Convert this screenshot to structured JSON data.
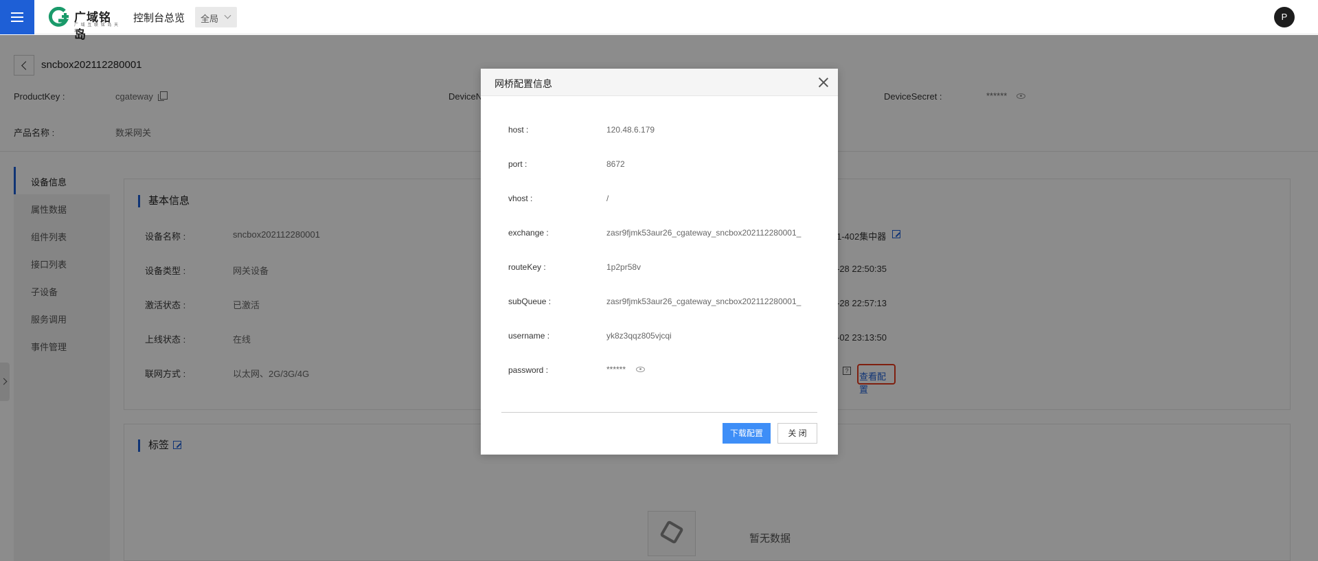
{
  "header": {
    "brand": "广域铭岛",
    "brand_sub": "广 域 互 联  铭 岛 天 地",
    "nav_title": "控制台总览",
    "scope": "全局",
    "avatar": "P"
  },
  "device": {
    "name": "sncbox202112280001",
    "product_key_label": "ProductKey :",
    "product_key_value": "cgateway",
    "device_name_label": "DeviceN",
    "device_secret_label": "DeviceSecret :",
    "device_secret_value": "******",
    "product_name_label": "产品名称 :",
    "product_name_value": "数采网关"
  },
  "sidebar": {
    "items": [
      {
        "label": "设备信息"
      },
      {
        "label": "属性数据"
      },
      {
        "label": "组件列表"
      },
      {
        "label": "接口列表"
      },
      {
        "label": "子设备"
      },
      {
        "label": "服务调用"
      },
      {
        "label": "事件管理"
      }
    ]
  },
  "basic_info": {
    "title": "基本信息",
    "rows": [
      {
        "label": "设备名称 :",
        "value": "sncbox202112280001"
      },
      {
        "label": "设备类型 :",
        "value": "网关设备"
      },
      {
        "label": "激活状态 :",
        "value": "已激活"
      },
      {
        "label": "上线状态 :",
        "value": "在线"
      },
      {
        "label": "联网方式 :",
        "value": "以太网、2G/3G/4G"
      }
    ],
    "right_values": [
      "1-402集中器",
      "-28 22:50:35",
      "-28 22:57:13",
      "-02 23:13:50"
    ],
    "help_text": "?",
    "view_config": "查看配置"
  },
  "tags": {
    "title": "标签",
    "empty_text": "暂无数据"
  },
  "modal": {
    "title": "网桥配置信息",
    "fields": [
      {
        "label": "host :",
        "value": "120.48.6.179"
      },
      {
        "label": "port :",
        "value": "8672"
      },
      {
        "label": "vhost :",
        "value": "/"
      },
      {
        "label": "exchange :",
        "value": "zasr9fjmk53aur26_cgateway_sncbox202112280001_"
      },
      {
        "label": "routeKey :",
        "value": "1p2pr58v"
      },
      {
        "label": "subQueue :",
        "value": "zasr9fjmk53aur26_cgateway_sncbox202112280001_"
      },
      {
        "label": "username :",
        "value": "yk8z3qqz805vjcqi"
      },
      {
        "label": "password :",
        "value": "******"
      }
    ],
    "download_button": "下载配置",
    "close_button": "关 闭"
  },
  "colors": {
    "primary": "#1e5fd6",
    "button_blue": "#3e8ef7",
    "highlight_red": "#e8391c"
  }
}
